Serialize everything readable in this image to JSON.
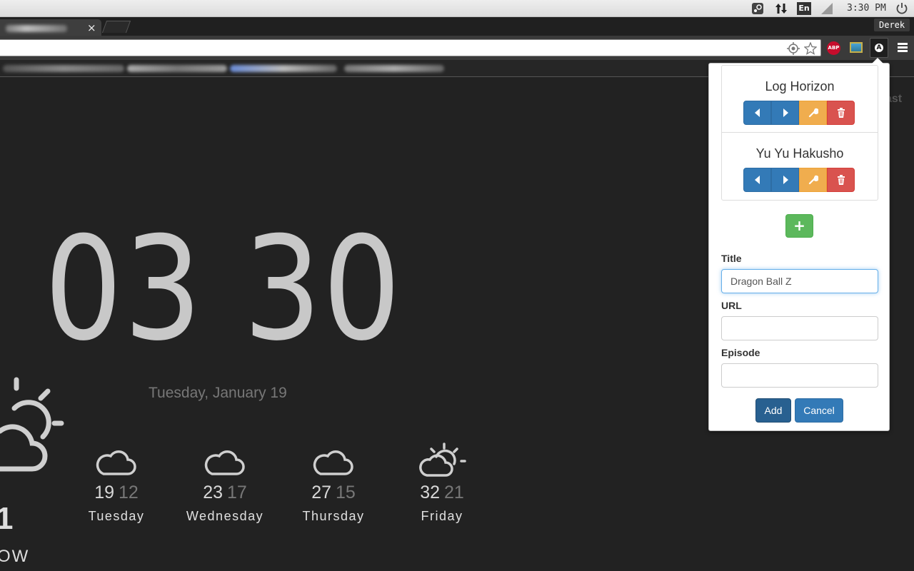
{
  "os_bar": {
    "language": "En",
    "time": "3:30 PM",
    "icons": [
      "steam-icon",
      "network-transfer-icon",
      "keyboard-language-icon",
      "signal-icon",
      "power-icon"
    ]
  },
  "browser": {
    "tab_close": "×",
    "profile_name": "Derek",
    "extensions": {
      "adblock_label": "ABP",
      "active_ext_glyph": "A"
    }
  },
  "page": {
    "clock": {
      "hours": "03",
      "minutes": "30"
    },
    "date": "Tuesday, January 19",
    "corner_text": "ast",
    "today": {
      "temp": "1",
      "label": "OW"
    },
    "forecast": [
      {
        "high": "19",
        "low": "12",
        "day": "Tuesday",
        "icon": "cloud-icon"
      },
      {
        "high": "23",
        "low": "17",
        "day": "Wednesday",
        "icon": "cloud-icon"
      },
      {
        "high": "27",
        "low": "15",
        "day": "Thursday",
        "icon": "cloud-icon"
      },
      {
        "high": "32",
        "low": "21",
        "day": "Friday",
        "icon": "partly-sunny-icon"
      }
    ]
  },
  "popup": {
    "shows": [
      {
        "title": "Log Horizon"
      },
      {
        "title": "Yu Yu Hakusho"
      }
    ],
    "add_show_glyph": "+",
    "form": {
      "title_label": "Title",
      "title_value": "Dragon Ball Z",
      "url_label": "URL",
      "url_value": "",
      "episode_label": "Episode",
      "episode_value": "",
      "add_label": "Add",
      "cancel_label": "Cancel"
    },
    "colors": {
      "primary": "#337ab7",
      "warning": "#f0ad4e",
      "danger": "#d9534f",
      "success": "#5cb85c"
    }
  }
}
